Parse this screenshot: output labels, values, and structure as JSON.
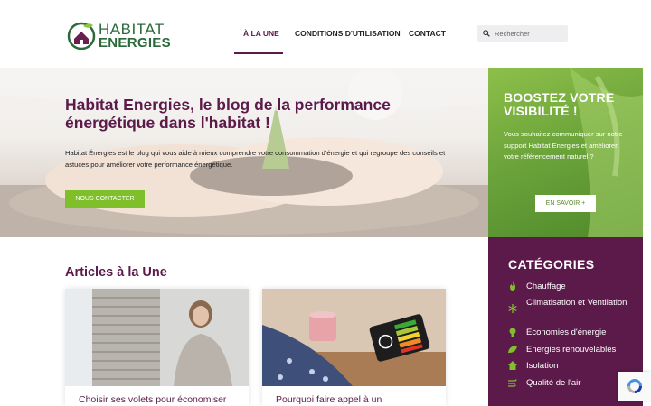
{
  "brand": {
    "line1": "HABITAT",
    "line2": "ENERGIES"
  },
  "nav": {
    "items": [
      {
        "label": "À LA UNE",
        "active": true
      },
      {
        "label": "CONDITIONS D'UTILISATION",
        "active": false
      },
      {
        "label": "CONTACT",
        "active": false
      }
    ]
  },
  "search": {
    "placeholder": "Rechercher",
    "value": ""
  },
  "hero": {
    "title": "Habitat Energies, le blog de la performance énergétique dans l'habitat !",
    "text": "Habitat Énergies est le blog qui vous aide à mieux comprendre votre consommation d'énergie et qui regroupe des conseils et astuces pour améliorer votre performance énergétique.",
    "button": "NOUS CONTACTER"
  },
  "promo": {
    "title": "BOOSTEZ VOTRE VISIBILITÉ !",
    "text": "Vous souhaitez communiquer sur notre support Habitat Energies et améliorer votre référencement naturel ?",
    "button": "EN SAVOIR +"
  },
  "articles": {
    "heading": "Articles à la Une",
    "items": [
      {
        "title": "Choisir ses volets pour économiser"
      },
      {
        "title": "Pourquoi faire appel à un"
      }
    ]
  },
  "categories": {
    "heading": "CATÉGORIES",
    "items": [
      {
        "label": "Chauffage",
        "icon": "flame-icon"
      },
      {
        "label": "Climatisation et Ventilation",
        "icon": "snowflake-icon"
      },
      {
        "label": "Economies d'énergie",
        "icon": "lightbulb-icon"
      },
      {
        "label": "Energies renouvelables",
        "icon": "leaf-icon"
      },
      {
        "label": "Isolation",
        "icon": "house-icon"
      },
      {
        "label": "Qualité de l'air",
        "icon": "wind-icon"
      }
    ]
  },
  "colors": {
    "brand_purple": "#5b1a4a",
    "brand_green": "#7fbf2a",
    "logo_green": "#2b6a3a"
  }
}
